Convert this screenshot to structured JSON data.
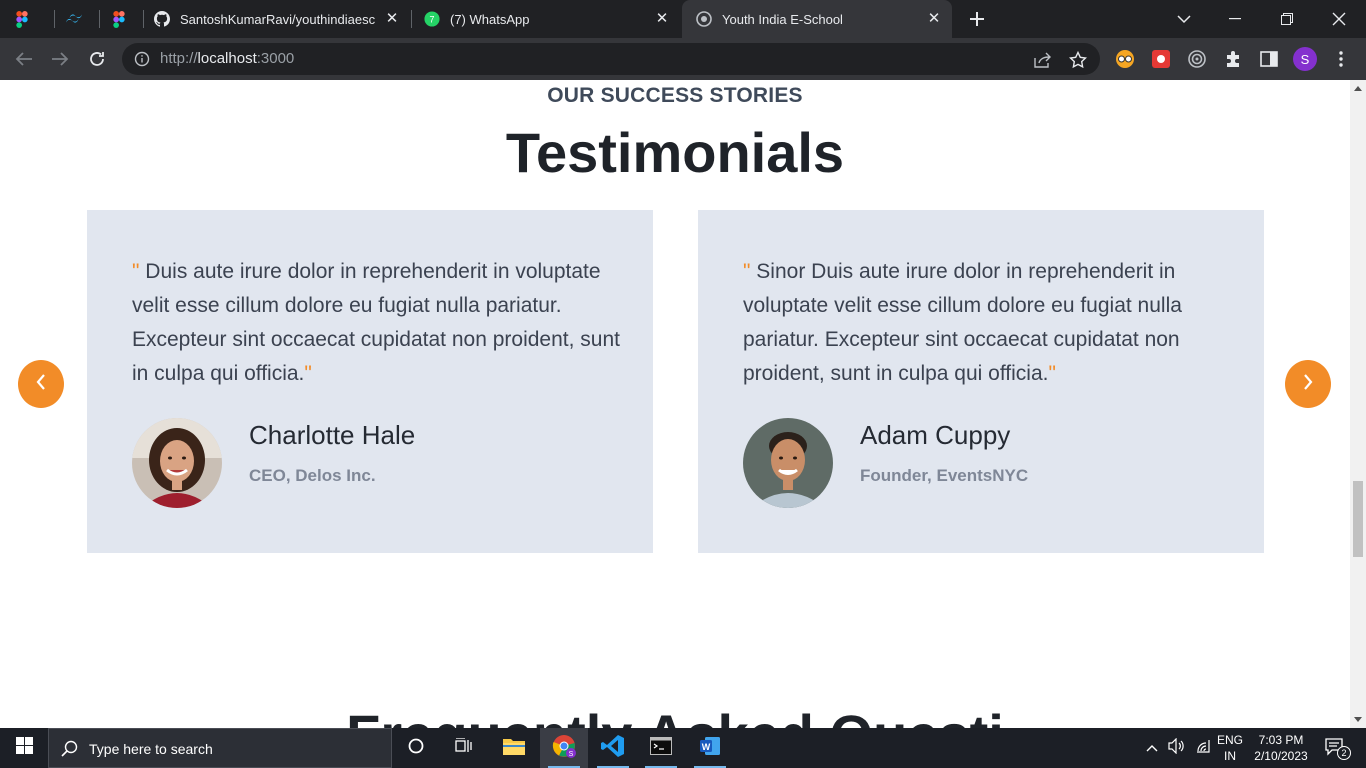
{
  "browser": {
    "tabs": [
      {
        "title": "",
        "icon": "figma-icon"
      },
      {
        "title": "",
        "icon": "tailwind-icon"
      },
      {
        "title": "",
        "icon": "figma-icon"
      },
      {
        "title": "SantoshKumarRavi/youthindiaesc",
        "icon": "github-icon"
      },
      {
        "title": "(7) WhatsApp",
        "icon": "whatsapp-icon"
      },
      {
        "title": "Youth India E-School",
        "icon": "site-icon"
      }
    ],
    "url_prefix": "http://",
    "url_host": "localhost",
    "url_port": ":3000",
    "profile_initial": "S"
  },
  "page": {
    "eyebrow": "OUR SUCCESS STORIES",
    "heading": "Testimonials",
    "faq_heading_peek": "Frequently Asked Questi",
    "testimonials": [
      {
        "quote": " Duis aute irure dolor in reprehenderit in voluptate velit esse cillum dolore eu fugiat nulla pariatur. Excepteur sint occaecat cupidatat non proident, sunt in culpa qui officia.",
        "name": "Charlotte Hale",
        "role": "CEO, Delos Inc."
      },
      {
        "quote": " Sinor Duis aute irure dolor in reprehenderit in voluptate velit esse cillum dolore eu fugiat nulla pariatur. Excepteur sint occaecat cupidatat non proident, sunt in culpa qui officia.",
        "name": "Adam Cuppy",
        "role": "Founder, EventsNYC"
      }
    ],
    "quote_mark": "\"",
    "accent_color": "#f28c28",
    "card_color": "#e1e6ef"
  },
  "taskbar": {
    "search_placeholder": "Type here to search",
    "lang_top": "ENG",
    "lang_bottom": "IN",
    "time": "7:03 PM",
    "date": "2/10/2023",
    "notification_count": "2"
  }
}
